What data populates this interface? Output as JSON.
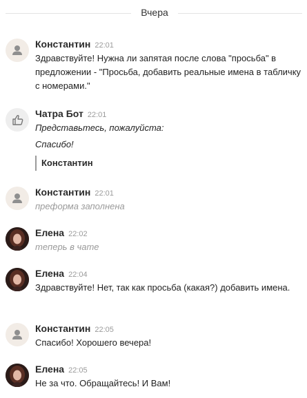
{
  "day_separator": "Вчера",
  "messages": [
    {
      "author": "Константин",
      "time": "22:01",
      "text": "Здравствуйте! Нужна ли запятая после слова \"просьба\" в предложении - \"Просьба, добавить реальные имена в табличку с номерами.\""
    },
    {
      "author": "Чатра Бот",
      "time": "22:01",
      "prompt": "Представьтесь, пожалуйста:",
      "thanks": "Спасибо!",
      "reply": "Константин"
    },
    {
      "author": "Константин",
      "time": "22:01",
      "text": "преформа заполнена"
    },
    {
      "author": "Елена",
      "time": "22:02",
      "text": "теперь в чате"
    },
    {
      "author": "Елена",
      "time": "22:04",
      "text": "Здравствуйте! Нет, так как просьба (какая?) добавить имена."
    },
    {
      "author": "Константин",
      "time": "22:05",
      "text": "Спасибо! Хорошего вечера!"
    },
    {
      "author": "Елена",
      "time": "22:05",
      "text": "Не за что. Обращайтесь! И Вам!"
    }
  ],
  "icons": {
    "user_avatar": "user-icon",
    "bot_avatar": "thumbs-up-icon",
    "operator_avatar": "photo"
  },
  "colors": {
    "name": "#2a2a2a",
    "time": "#9a9a9a",
    "note": "#9a9a9a",
    "separator_line": "#e3e3e3",
    "user_avatar_bg": "#f2ece6"
  }
}
